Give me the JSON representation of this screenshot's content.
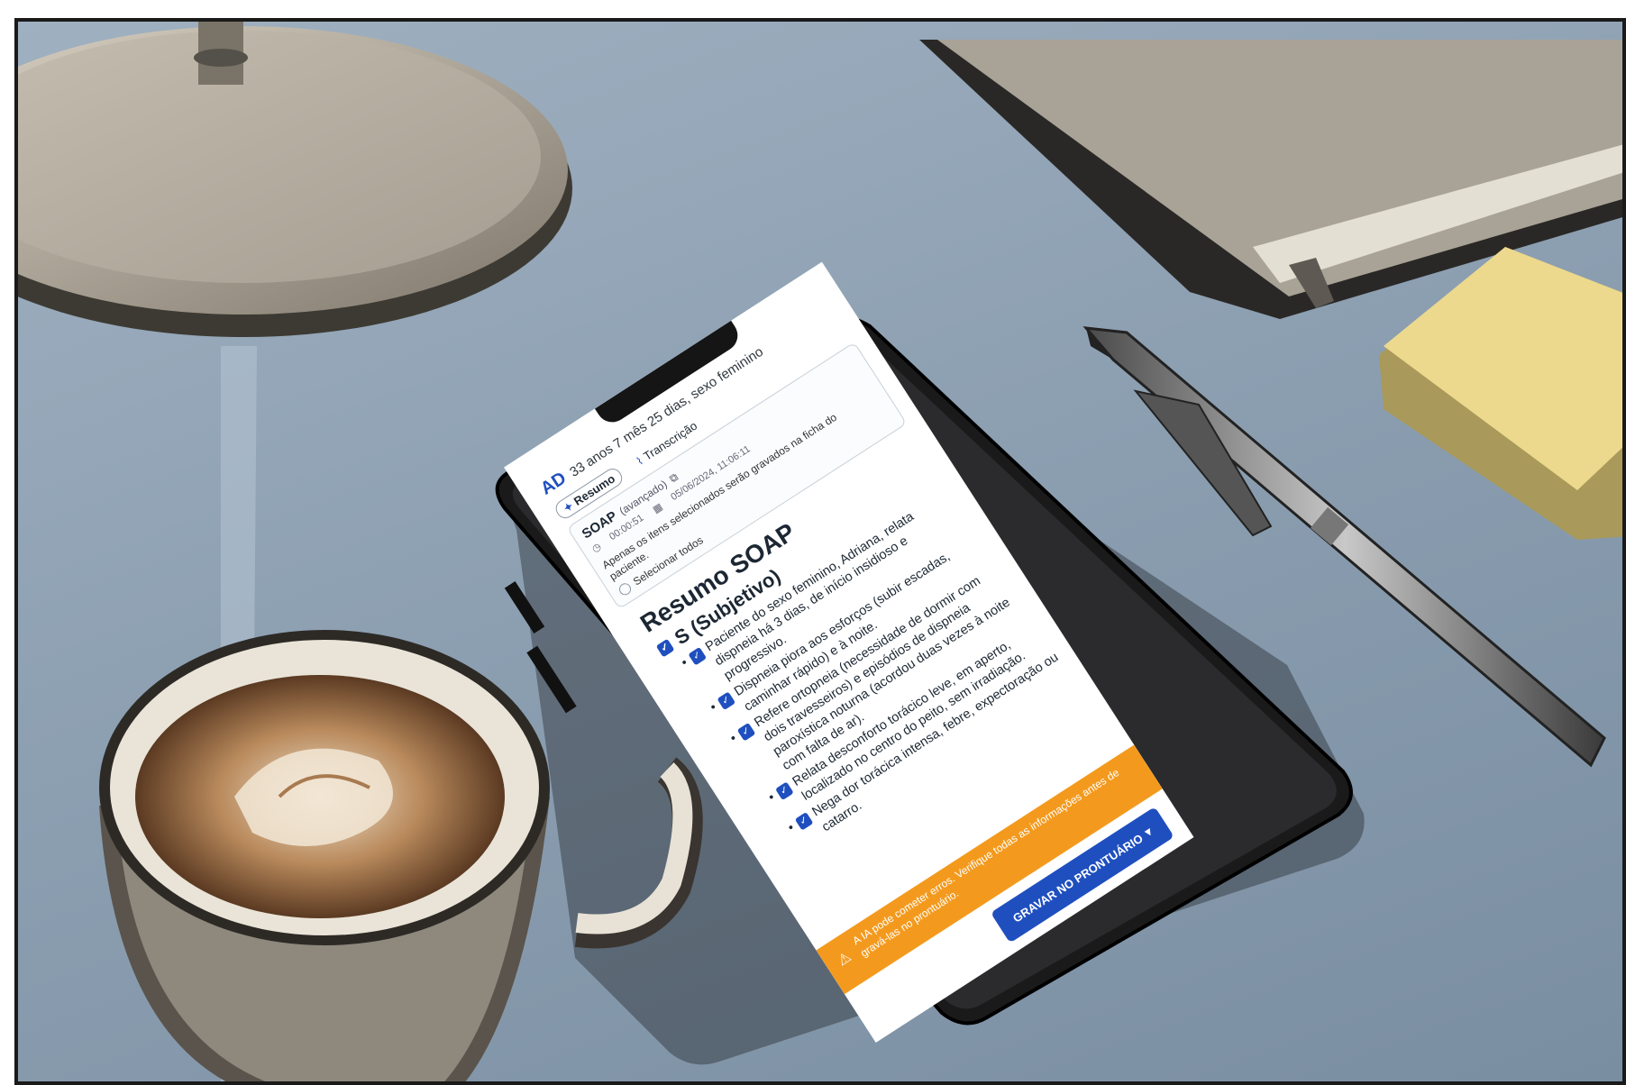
{
  "patient": {
    "avatar_initials": "AD",
    "info": "33 anos 7 mês 25 dias, sexo feminino"
  },
  "tabs": [
    {
      "label": "Resumo",
      "icon": "sparkle-icon"
    },
    {
      "label": "Transcrição",
      "icon": "waveform-icon"
    }
  ],
  "soap_card": {
    "title": "SOAP",
    "variant": "(avançado)",
    "duration": "00:00:51",
    "date": "05/06/2024, 11:06:11",
    "notice": "Apenas os itens selecionados serão gravados na ficha do paciente.",
    "select_all": "Selecionar todos"
  },
  "summary": {
    "title": "Resumo SOAP",
    "section": "S (Subjetivo)",
    "items": [
      "Paciente do sexo feminino, Adriana, relata dispneia há 3 dias, de início insidioso e progressivo.",
      "Dispneia piora aos esforços (subir escadas, caminhar rápido) e à noite.",
      "Refere ortopneia (necessidade de dormir com dois travesseiros) e episódios de dispneia paroxística noturna (acordou duas vezes à noite com falta de ar).",
      "Relata desconforto torácico leve, em aperto, localizado no centro do peito, sem irradiação.",
      "Nega dor torácica intensa, febre, expectoração ou catarro."
    ]
  },
  "warning": "A IA pode cometer erros. Verifique todas as informações antes de gravá-las no prontuário.",
  "save_button": "GRAVAR NO PRONTUÁRIO",
  "colors": {
    "primary": "#1f4fbf",
    "warning": "#f39a1e",
    "desk": "#8da0b2"
  }
}
